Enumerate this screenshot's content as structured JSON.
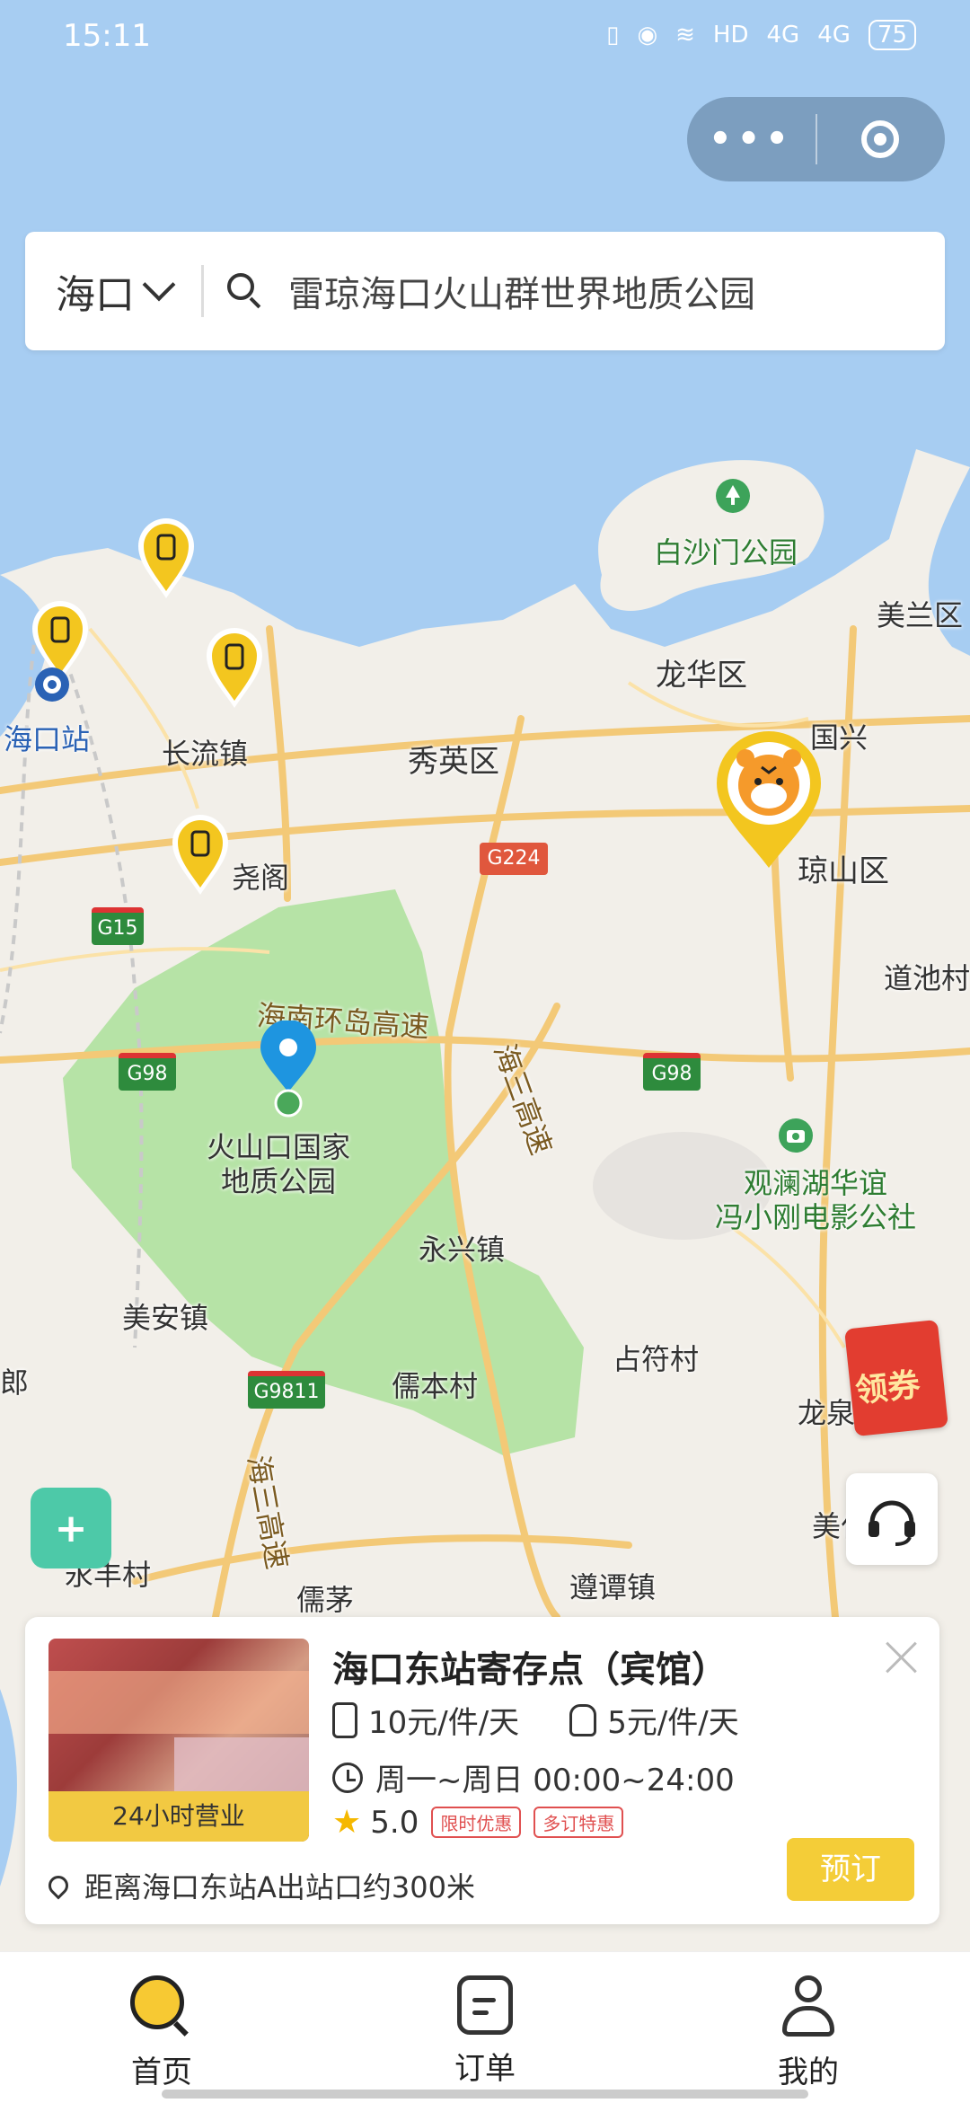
{
  "status": {
    "time": "15:11",
    "battery": "75",
    "net1": "4G",
    "net2": "4G",
    "hd": "HD"
  },
  "search": {
    "city": "海口",
    "query": "雷琼海口火山群世界地质公园"
  },
  "map": {
    "labels": [
      {
        "id": "baisha",
        "text": "白沙门公园"
      },
      {
        "id": "meilan",
        "text": "美兰区"
      },
      {
        "id": "longhua",
        "text": "龙华区"
      },
      {
        "id": "guoxing",
        "text": "国兴"
      },
      {
        "id": "haikouzhan",
        "text": "海口站"
      },
      {
        "id": "changliu",
        "text": "长流镇"
      },
      {
        "id": "xiuying",
        "text": "秀英区"
      },
      {
        "id": "qiongshan",
        "text": "琼山区"
      },
      {
        "id": "yaoge",
        "text": "尧阁"
      },
      {
        "id": "daochi",
        "text": "道池村"
      },
      {
        "id": "huanddao",
        "text": "海南环岛高速"
      },
      {
        "id": "haisan1",
        "text": "海三高速"
      },
      {
        "id": "huoshan",
        "text": "火山口国家\n地质公园"
      },
      {
        "id": "guanlan",
        "text": "观澜湖华谊\n冯小刚电影公社"
      },
      {
        "id": "yongxing",
        "text": "永兴镇"
      },
      {
        "id": "meian",
        "text": "美安镇"
      },
      {
        "id": "zhanfu",
        "text": "占符村"
      },
      {
        "id": "ruben",
        "text": "儒本村"
      },
      {
        "id": "longquan",
        "text": "龙泉"
      },
      {
        "id": "meiren",
        "text": "美仁"
      },
      {
        "id": "yongfeng",
        "text": "永丰村"
      },
      {
        "id": "rumao",
        "text": "儒茅"
      },
      {
        "id": "zuntan",
        "text": "遵谭镇"
      },
      {
        "id": "haisan2",
        "text": "海三高速"
      },
      {
        "id": "lang",
        "text": "郎"
      }
    ],
    "shields": {
      "g15": "G15",
      "g224": "G224",
      "g98a": "G98",
      "g98b": "G98",
      "g9811": "G9811"
    }
  },
  "coupon": {
    "label": "领券"
  },
  "card": {
    "title": "海口东站寄存点（宾馆）",
    "badge": "24小时营业",
    "price_luggage": "10元/件/天",
    "price_backpack": "5元/件/天",
    "hours": "周一~周日 00:00~24:00",
    "rating": "5.0",
    "tags": [
      "限时优惠",
      "多订特惠"
    ],
    "distance": "距离海口东站A出站口约300米",
    "book_label": "预订"
  },
  "tabs": [
    {
      "label": "首页",
      "icon": "home-search-icon"
    },
    {
      "label": "订单",
      "icon": "order-icon"
    },
    {
      "label": "我的",
      "icon": "profile-icon"
    }
  ],
  "colors": {
    "accent": "#f7c933",
    "sea": "#a7cdf2",
    "park": "#b6e3a6",
    "pin_blue": "#1e95e0"
  }
}
